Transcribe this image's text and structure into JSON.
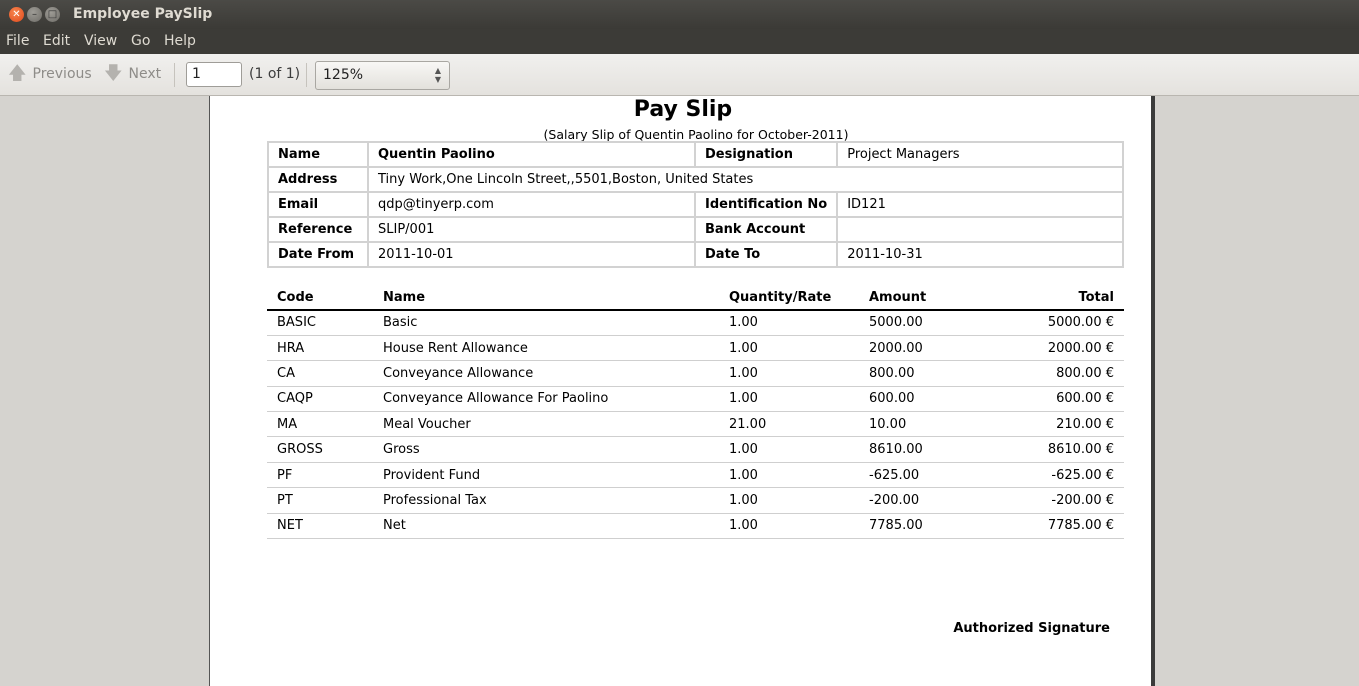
{
  "window": {
    "title": "Employee PaySlip",
    "controls": [
      "close-icon",
      "minimize-icon",
      "maximize-icon"
    ]
  },
  "menubar": [
    "File",
    "Edit",
    "View",
    "Go",
    "Help"
  ],
  "toolbar": {
    "previous_label": "Previous",
    "next_label": "Next",
    "page_value": "1",
    "page_count": "(1 of 1)",
    "zoom_value": "125%"
  },
  "document": {
    "title": "Pay Slip",
    "subtitle": "(Salary Slip of Quentin Paolino for October-2011)",
    "info": {
      "name_label": "Name",
      "name_value": "Quentin Paolino",
      "designation_label": "Designation",
      "designation_value": "Project Managers",
      "address_label": "Address",
      "address_value": "Tiny Work,One Lincoln Street,,5501,Boston, United States",
      "email_label": "Email",
      "email_value": "qdp@tinyerp.com",
      "idno_label": "Identification No",
      "idno_value": "ID121",
      "reference_label": "Reference",
      "reference_value": "SLIP/001",
      "bank_label": "Bank Account",
      "bank_value": "",
      "datefrom_label": "Date From",
      "datefrom_value": "2011-10-01",
      "dateto_label": "Date To",
      "dateto_value": "2011-10-31"
    },
    "lines": {
      "headers": {
        "code": "Code",
        "name": "Name",
        "qty": "Quantity/Rate",
        "amount": "Amount",
        "total": "Total"
      },
      "rows": [
        {
          "code": "BASIC",
          "name": "Basic",
          "qty": "1.00",
          "amount": "5000.00",
          "total": "5000.00 €"
        },
        {
          "code": "HRA",
          "name": "House Rent Allowance",
          "qty": "1.00",
          "amount": "2000.00",
          "total": "2000.00 €"
        },
        {
          "code": "CA",
          "name": "Conveyance Allowance",
          "qty": "1.00",
          "amount": "800.00",
          "total": "800.00 €"
        },
        {
          "code": "CAQP",
          "name": "Conveyance Allowance For Paolino",
          "qty": "1.00",
          "amount": "600.00",
          "total": "600.00 €"
        },
        {
          "code": "MA",
          "name": "Meal Voucher",
          "qty": "21.00",
          "amount": "10.00",
          "total": "210.00 €"
        },
        {
          "code": "GROSS",
          "name": "Gross",
          "qty": "1.00",
          "amount": "8610.00",
          "total": "8610.00 €"
        },
        {
          "code": "PF",
          "name": "Provident Fund",
          "qty": "1.00",
          "amount": "-625.00",
          "total": "-625.00 €"
        },
        {
          "code": "PT",
          "name": "Professional Tax",
          "qty": "1.00",
          "amount": "-200.00",
          "total": "-200.00 €"
        },
        {
          "code": "NET",
          "name": "Net",
          "qty": "1.00",
          "amount": "7785.00",
          "total": "7785.00 €"
        }
      ]
    },
    "signature": "Authorized Signature"
  }
}
